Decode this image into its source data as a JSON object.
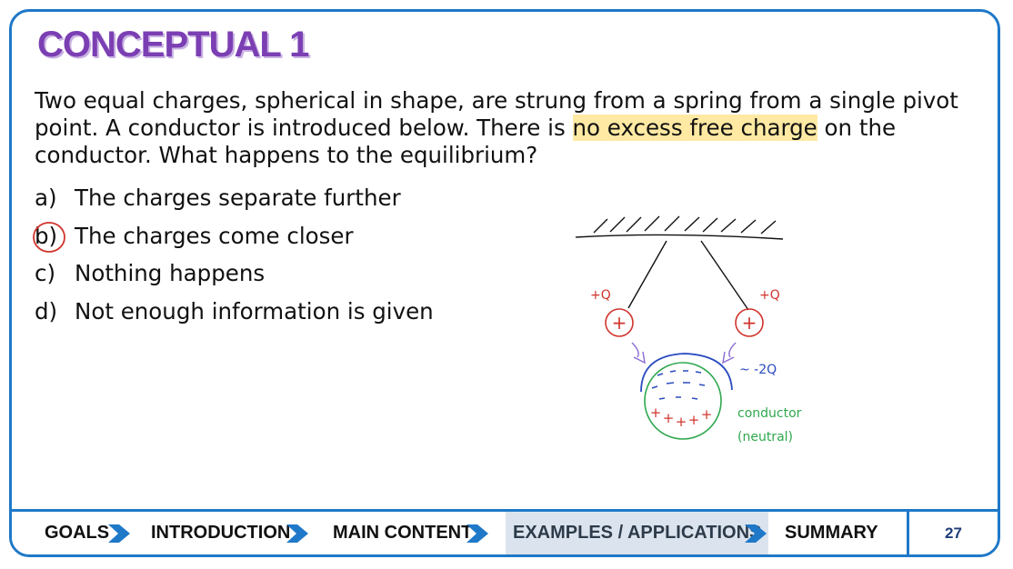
{
  "slide": {
    "title": "CONCEPTUAL 1",
    "question_before": "Two equal charges, spherical in shape, are strung from a spring from a single pivot point. A conductor is introduced below. There is ",
    "question_highlight": "no excess free charge",
    "question_after": " on the conductor. What happens to the equilibrium?",
    "options": [
      {
        "letter": "a)",
        "text": "The charges separate further"
      },
      {
        "letter": "b)",
        "text": "The charges come closer"
      },
      {
        "letter": "c)",
        "text": "Nothing happens"
      },
      {
        "letter": "d)",
        "text": "Not enough information is given"
      }
    ],
    "selected_option": "b)",
    "highlight_color": "#ffe9a3",
    "title_color": "#7b3fb3"
  },
  "drawing": {
    "left_charge_label": "+Q",
    "right_charge_label": "+Q",
    "induced_label": "~ -2Q",
    "conductor_label": "conductor",
    "neutral_label": "(neutral)",
    "charge_sign": "+",
    "colors": {
      "charge": "#d0342c",
      "induced": "#2b4bbf",
      "conductor": "#2fa84f",
      "arrow": "#8a6bd6"
    }
  },
  "nav": {
    "items": [
      "GOALS",
      "INTRODUCTION",
      "MAIN CONTENT",
      "EXAMPLES / APPLICATIONS",
      "SUMMARY"
    ],
    "active_index": 3,
    "page_number": "27",
    "accent_color": "#1f78c8"
  }
}
